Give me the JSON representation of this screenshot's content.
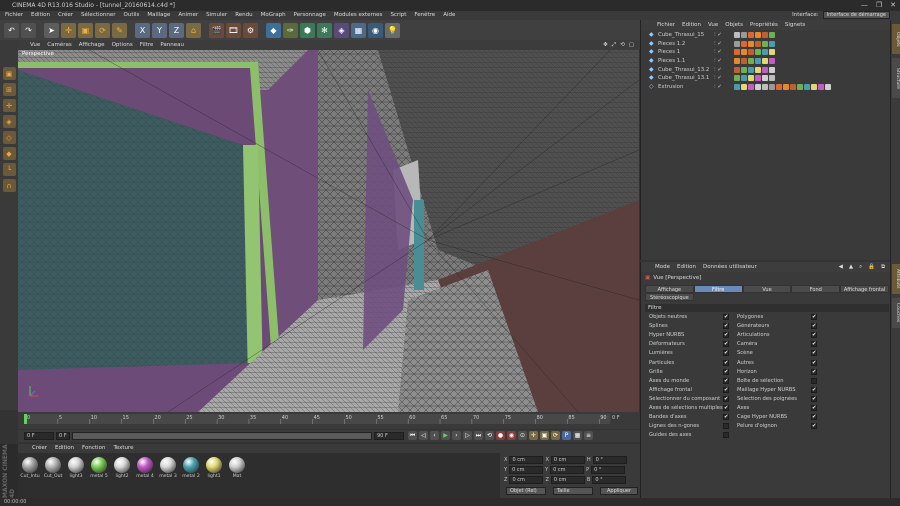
{
  "window": {
    "title": "CINEMA 4D R13.016 Studio - [tunnel_20160614.c4d *]",
    "controls": [
      "—",
      "❐",
      "✕"
    ]
  },
  "menubar": {
    "items": [
      "Fichier",
      "Edition",
      "Créer",
      "Sélectionner",
      "Outils",
      "Maillage",
      "Animer",
      "Simuler",
      "Rendu",
      "MoGraph",
      "Personnage",
      "Modules externes",
      "Script",
      "Fenêtre",
      "Aide"
    ],
    "interface_label": "Interface:",
    "interface_value": "Interface de démarrage"
  },
  "toolbar": {
    "axis_buttons": [
      "X",
      "Y",
      "Z"
    ]
  },
  "viewport": {
    "menu": [
      "Vue",
      "Caméras",
      "Affichage",
      "Options",
      "Filtre",
      "Panneau"
    ],
    "label": "Perspective",
    "icons": [
      "move-view-icon",
      "zoom-view-icon",
      "rotate-view-icon",
      "maximize-view-icon"
    ]
  },
  "timeline": {
    "ticks": [
      "0",
      "5",
      "10",
      "15",
      "20",
      "25",
      "30",
      "35",
      "40",
      "45",
      "50",
      "55",
      "60",
      "65",
      "70",
      "75",
      "80",
      "85",
      "90"
    ],
    "frame_end_label": "0 F",
    "current_frame": "0 F",
    "start_field": "0 F",
    "min_field": "0",
    "max_field": "90 F",
    "end_field": "90 F"
  },
  "materials": {
    "menu": [
      "Créer",
      "Edition",
      "Fonction",
      "Texture"
    ],
    "items": [
      {
        "name": "Cut_Intu",
        "color": "#a8a8a8"
      },
      {
        "name": "Cut_Out",
        "color": "#b4b4b4"
      },
      {
        "name": "light3",
        "color": "#d0d0d0"
      },
      {
        "name": "metal 5",
        "color": "#7ccf54"
      },
      {
        "name": "light2",
        "color": "#d8d8d8"
      },
      {
        "name": "metal 4",
        "color": "#c55ac8"
      },
      {
        "name": "metal 3",
        "color": "#d8d8d8"
      },
      {
        "name": "metal 2",
        "color": "#4aa5b0"
      },
      {
        "name": "light1",
        "color": "#e0d870"
      },
      {
        "name": "Mat",
        "color": "#cfcfcf"
      }
    ],
    "brand": "MAXON CINEMA 4D"
  },
  "coords": {
    "rows": [
      {
        "a": "X",
        "a_val": "0 cm",
        "b": "X",
        "b_val": "0 cm",
        "c": "H",
        "c_val": "0 °"
      },
      {
        "a": "Y",
        "a_val": "0 cm",
        "b": "Y",
        "b_val": "0 cm",
        "c": "P",
        "c_val": "0 °"
      },
      {
        "a": "Z",
        "a_val": "0 cm",
        "b": "Z",
        "b_val": "0 cm",
        "c": "B",
        "c_val": "0 °"
      }
    ],
    "mode_select": "Objet (Rel)",
    "size_select": "Taille",
    "apply_button": "Appliquer"
  },
  "status": {
    "text": "00:00:00"
  },
  "objects": {
    "menu": [
      "Fichier",
      "Edition",
      "Vue",
      "Objets",
      "Propriétés",
      "Signets"
    ],
    "items": [
      {
        "name": "Cube_Thrasui_15",
        "icon": "◆"
      },
      {
        "name": "Pieces 1.2",
        "icon": "◆"
      },
      {
        "name": "Pieces 1",
        "icon": "◆"
      },
      {
        "name": "Pieces 1.1",
        "icon": "◆"
      },
      {
        "name": "Cube_Thrasui_13.2",
        "icon": "◆"
      },
      {
        "name": "Cube_Thrasui_13.1",
        "icon": "◆"
      },
      {
        "name": "Extrusion",
        "icon": "◇"
      }
    ]
  },
  "attributes": {
    "menu": [
      "Mode",
      "Edition",
      "Données utilisateur"
    ],
    "title": "Vue [Perspective]",
    "tabs": [
      "Affichage",
      "Filtre",
      "Vue",
      "Fond",
      "Affichage frontal",
      "Stéréoscopique"
    ],
    "active_tab": "Filtre",
    "section": "Filtre",
    "left_filters": [
      {
        "label": "Objets neutres",
        "checked": "✔"
      },
      {
        "label": "Splines",
        "checked": "✔"
      },
      {
        "label": "Hyper NURBS",
        "checked": "✔"
      },
      {
        "label": "Déformateurs",
        "checked": "✔"
      },
      {
        "label": "Lumières",
        "checked": "✔"
      },
      {
        "label": "Particules",
        "checked": "✔"
      },
      {
        "label": "Grille",
        "checked": "✔"
      },
      {
        "label": "Axes du monde",
        "checked": "✔"
      },
      {
        "label": "Affichage frontal",
        "checked": "✔"
      },
      {
        "label": "Sélectionner du composant",
        "checked": "✔"
      },
      {
        "label": "Axes de sélections multiples",
        "checked": "✔"
      },
      {
        "label": "Bandes d'axes",
        "checked": "✔"
      },
      {
        "label": "Lignes des n-gones",
        "checked": ""
      },
      {
        "label": "Guides des axes",
        "checked": ""
      }
    ],
    "right_filters": [
      {
        "label": "Polygones",
        "checked": "✔"
      },
      {
        "label": "Générateurs",
        "checked": "✔"
      },
      {
        "label": "Articulations",
        "checked": "✔"
      },
      {
        "label": "Caméra",
        "checked": "✔"
      },
      {
        "label": "Scène",
        "checked": "✔"
      },
      {
        "label": "Autres",
        "checked": "✔"
      },
      {
        "label": "Horizon",
        "checked": "✔"
      },
      {
        "label": "Boîte de sélection",
        "checked": ""
      },
      {
        "label": "Maillage Hyper NURBS",
        "checked": "✔"
      },
      {
        "label": "Sélection des poignées",
        "checked": "✔"
      },
      {
        "label": "Axes",
        "checked": "✔"
      },
      {
        "label": "Cage Hyper NURBS",
        "checked": "✔"
      },
      {
        "label": "Pelure d'oignon",
        "checked": "✔"
      }
    ]
  },
  "side_tabs": [
    "Objets",
    "Structure",
    "Attributs",
    "Couches"
  ]
}
